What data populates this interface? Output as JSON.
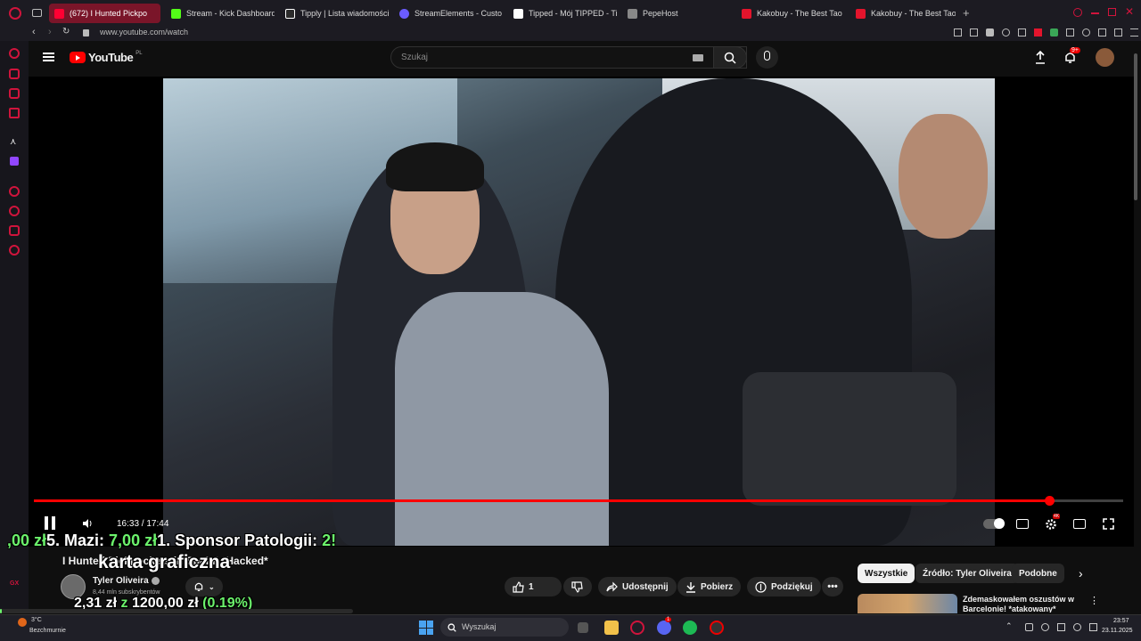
{
  "tabs": [
    {
      "title": "(672) I Hunted Pickpo",
      "color": "#ff0033",
      "active": true
    },
    {
      "title": "Stream - Kick Dashboard",
      "color": "#53fc18"
    },
    {
      "title": "Tipply | Lista wiadomości",
      "color": "#ffffff"
    },
    {
      "title": "StreamElements - Custo",
      "color": "#6b5cff"
    },
    {
      "title": "Tipped - Mój TIPPED - Ti",
      "color": "#ffffff"
    },
    {
      "title": "PepeHost",
      "color": "#888888"
    },
    {
      "title": "Kakobuy - The Best Tao",
      "color": "#e3142c"
    },
    {
      "title": "Kakobuy - The Best Tao",
      "color": "#e3142c"
    }
  ],
  "address": {
    "url": "www.youtube.com/watch"
  },
  "youtube": {
    "logo_text": "YouTube",
    "region": "PL",
    "search_placeholder": "Szukaj",
    "notification_badge": "9+"
  },
  "player": {
    "current_time": "16:33",
    "duration": "17:44",
    "time_display": "16:33 / 17:44",
    "progress": 0.9323,
    "settings_badge": "4K"
  },
  "overlay": {
    "ticker": ",00 zł5. Mazi: 7,00 zł1. Sponsor Patologii: 2",
    "ticker_parts": [
      {
        "text": ",00 zł",
        "color": "#6cf36c"
      },
      {
        "text": "5. Mazi: ",
        "color": "#ffffff"
      },
      {
        "text": "7,00 zł",
        "color": "#6cf36c"
      },
      {
        "text": "1. Sponsor Patologii: ",
        "color": "#ffffff"
      },
      {
        "text": "2!",
        "color": "#6cf36c"
      }
    ],
    "goal_title": "karta graficzna",
    "goal_current": "2,31 zł",
    "goal_sep": "z",
    "goal_target": "1200,00 zł",
    "goal_percent": "(0.19%)",
    "goal_progress": 0.0019
  },
  "video": {
    "title": "I Hunted Pickpockets in Spain! *Hacked*",
    "channel": "Tyler Oliveira",
    "subscribers": "8,44 mln subskrybentów",
    "like_count": "1",
    "actions": {
      "share": "Udostępnij",
      "download": "Pobierz",
      "thanks": "Podziękuj"
    }
  },
  "recommendations": {
    "chips": [
      "Wszystkie",
      "Źródło: Tyler Oliveira",
      "Podobne"
    ],
    "first_title": "Zdemaskowałem oszustów w Barcelonie! *atakowany*"
  },
  "taskbar": {
    "search_placeholder": "Wyszukaj",
    "weather_text": "Bezchmurnie",
    "weather_temp": "3°C",
    "time": "23:57",
    "date": "23.11.2025",
    "discord_badge": "1"
  },
  "colors": {
    "accent": "#ff0000",
    "opera_red": "#d0143c",
    "ticker_green": "#6cf36c"
  }
}
